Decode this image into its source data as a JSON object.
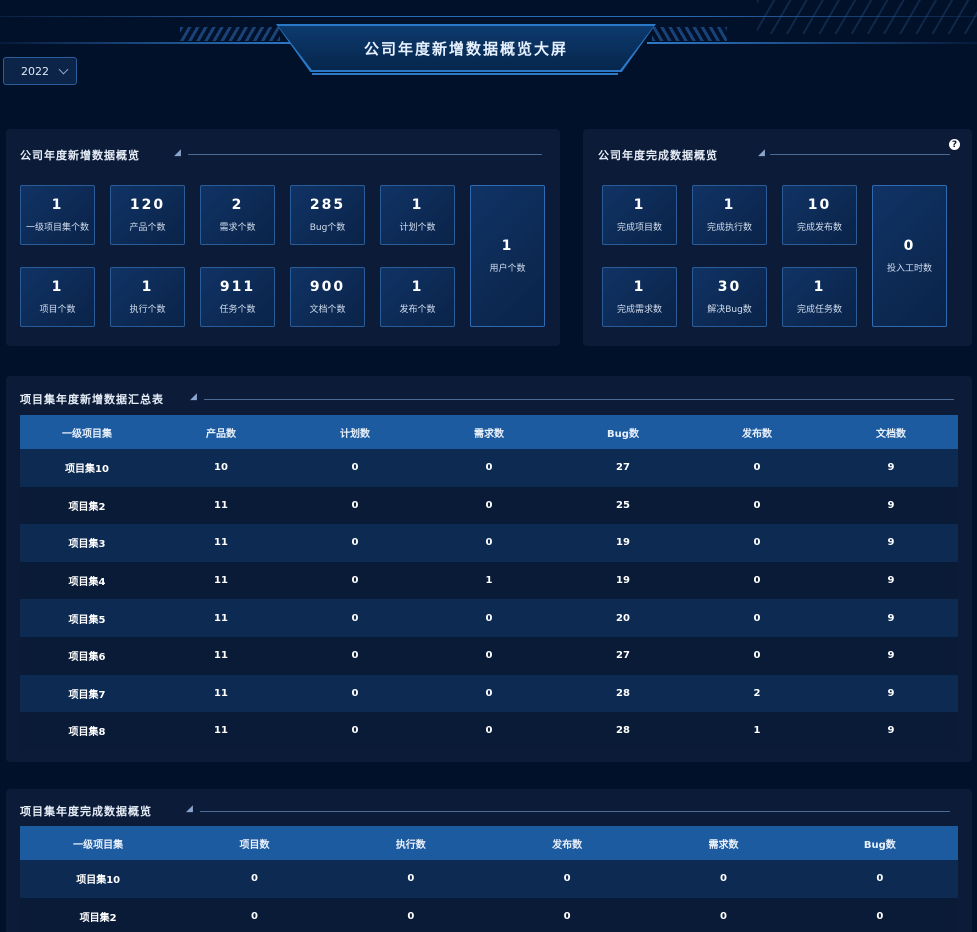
{
  "header": {
    "title": "公司年度新增数据概览大屏"
  },
  "year_select": {
    "value": "2022"
  },
  "new_overview": {
    "title": "公司年度新增数据概览",
    "stats": [
      {
        "value": "1",
        "label": "一级项目集个数"
      },
      {
        "value": "120",
        "label": "产品个数"
      },
      {
        "value": "2",
        "label": "需求个数"
      },
      {
        "value": "285",
        "label": "Bug个数"
      },
      {
        "value": "1",
        "label": "计划个数"
      },
      {
        "value": "1",
        "label": "项目个数"
      },
      {
        "value": "1",
        "label": "执行个数"
      },
      {
        "value": "911",
        "label": "任务个数"
      },
      {
        "value": "900",
        "label": "文档个数"
      },
      {
        "value": "1",
        "label": "发布个数"
      }
    ],
    "tall_stat": {
      "value": "1",
      "label": "用户个数"
    }
  },
  "done_overview": {
    "title": "公司年度完成数据概览",
    "stats": [
      {
        "value": "1",
        "label": "完成项目数"
      },
      {
        "value": "1",
        "label": "完成执行数"
      },
      {
        "value": "10",
        "label": "完成发布数"
      },
      {
        "value": "1",
        "label": "完成需求数"
      },
      {
        "value": "30",
        "label": "解决Bug数"
      },
      {
        "value": "1",
        "label": "完成任务数"
      }
    ],
    "tall_stat": {
      "value": "0",
      "label": "投入工时数"
    }
  },
  "new_table": {
    "title": "项目集年度新增数据汇总表",
    "columns": [
      "一级项目集",
      "产品数",
      "计划数",
      "需求数",
      "Bug数",
      "发布数",
      "文档数"
    ],
    "rows": [
      [
        "项目集10",
        "10",
        "0",
        "0",
        "27",
        "0",
        "9"
      ],
      [
        "项目集2",
        "11",
        "0",
        "0",
        "25",
        "0",
        "9"
      ],
      [
        "项目集3",
        "11",
        "0",
        "0",
        "19",
        "0",
        "9"
      ],
      [
        "项目集4",
        "11",
        "0",
        "1",
        "19",
        "0",
        "9"
      ],
      [
        "项目集5",
        "11",
        "0",
        "0",
        "20",
        "0",
        "9"
      ],
      [
        "项目集6",
        "11",
        "0",
        "0",
        "27",
        "0",
        "9"
      ],
      [
        "项目集7",
        "11",
        "0",
        "0",
        "28",
        "2",
        "9"
      ],
      [
        "项目集8",
        "11",
        "0",
        "0",
        "28",
        "1",
        "9"
      ]
    ]
  },
  "done_table": {
    "title": "项目集年度完成数据概览",
    "columns": [
      "一级项目集",
      "项目数",
      "执行数",
      "发布数",
      "需求数",
      "Bug数"
    ],
    "rows": [
      [
        "项目集10",
        "0",
        "0",
        "0",
        "0",
        "0"
      ],
      [
        "项目集2",
        "0",
        "0",
        "0",
        "0",
        "0"
      ]
    ]
  }
}
